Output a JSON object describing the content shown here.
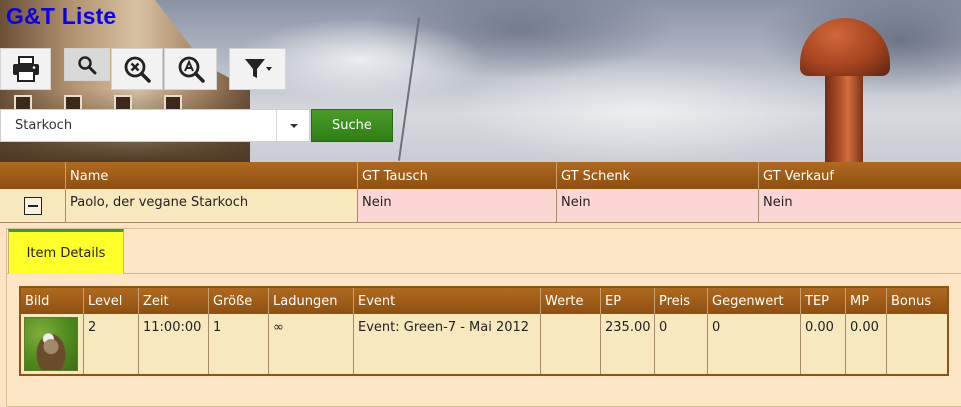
{
  "app": {
    "title": "G&T Liste"
  },
  "toolbar": {
    "buttons": [
      {
        "name": "print",
        "icon": "printer-icon"
      },
      {
        "name": "search",
        "icon": "search-icon"
      },
      {
        "name": "clear-search",
        "icon": "zoom-x-icon"
      },
      {
        "name": "advanced-search",
        "icon": "zoom-a-icon"
      },
      {
        "name": "filter",
        "icon": "filter-icon"
      }
    ]
  },
  "search": {
    "value": "Starkoch",
    "button_label": "Suche"
  },
  "grid": {
    "columns": [
      "Name",
      "GT Tausch",
      "GT Schenk",
      "GT Verkauf"
    ],
    "rows": [
      {
        "name": "Paolo, der vegane Starkoch",
        "gt_tausch": "Nein",
        "gt_schenk": "Nein",
        "gt_verkauf": "Nein"
      }
    ]
  },
  "details": {
    "tab_label": "Item Details",
    "columns": [
      "Bild",
      "Level",
      "Zeit",
      "Größe",
      "Ladungen",
      "Event",
      "Werte",
      "EP",
      "Preis",
      "Gegenwert",
      "TEP",
      "MP",
      "Bonus"
    ],
    "row": {
      "bild": "",
      "level": "2",
      "zeit": "11:00:00",
      "groesse": "1",
      "ladungen": "∞",
      "event": "Event: Green-7 - Mai 2012",
      "werte": "",
      "ep": "235.00",
      "preis": "0",
      "gegenwert": "0",
      "tep": "0.00",
      "mp": "0.00",
      "bonus": ""
    }
  },
  "colors": {
    "title": "#0a00e6",
    "header": "#9c5a16",
    "row": "#f8e8bd",
    "pink": "#fcd6d4",
    "search_button": "#3a8a1d",
    "tab_active": "#ffff2a"
  }
}
